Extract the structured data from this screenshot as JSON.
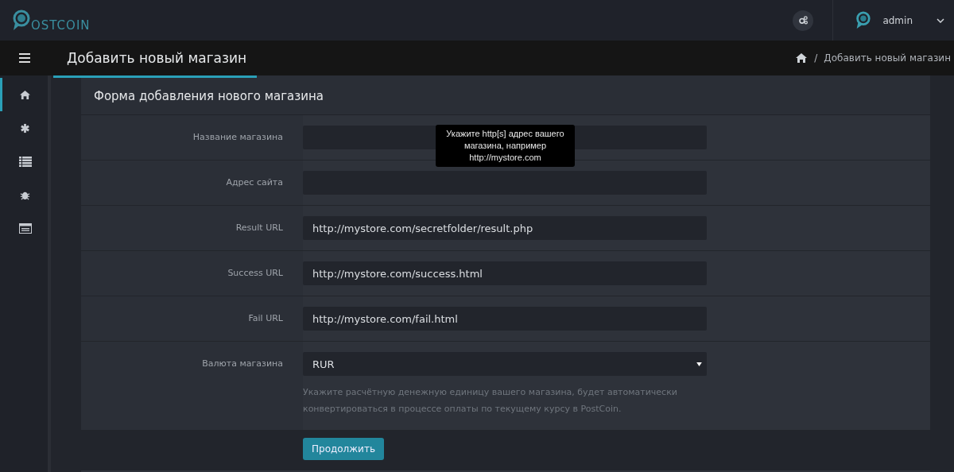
{
  "header": {
    "logo": "OSTCOIN",
    "user": "admin"
  },
  "titlebar": {
    "title": "Добавить новый магазин",
    "breadcrumb_sep": "/",
    "breadcrumb": "Добавить новый магазин"
  },
  "sidebar": {
    "items": [
      {
        "kind": "home",
        "selected": true
      },
      {
        "kind": "asterisk",
        "selected": false
      },
      {
        "kind": "list",
        "selected": false
      },
      {
        "kind": "bug",
        "selected": false
      },
      {
        "kind": "card",
        "selected": false
      }
    ]
  },
  "form": {
    "title": "Форма добавления нового магазина",
    "fields": [
      {
        "kind": "text",
        "label": "Название магазина"
      },
      {
        "kind": "text",
        "label": "Адрес сайта",
        "tooltip": "Укажите http[s] адрес вашего магазина, например http://mystore.com"
      },
      {
        "kind": "text",
        "label": "Result URL",
        "value": "http://mystore.com/secretfolder/result.php"
      },
      {
        "kind": "text",
        "label": "Success URL",
        "value": "http://mystore.com/success.html"
      },
      {
        "kind": "text",
        "label": "Fail URL",
        "value": "http://mystore.com/fail.html"
      },
      {
        "kind": "select",
        "label": "Валюта магазина",
        "value": "RUR",
        "help": "Укажите расчётную денежную единицу вашего магазина, будет автоматически конвертироваться в процессе оплаты по текущему курсу в PostCoin."
      }
    ],
    "submit": "Продолжить"
  }
}
